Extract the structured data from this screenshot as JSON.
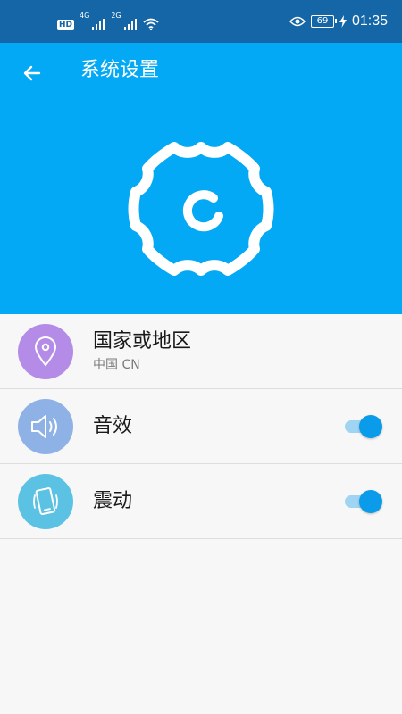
{
  "status_bar": {
    "hd_label": "HD",
    "net1_label": "4G",
    "net2_label": "2G",
    "battery_level": "69",
    "time": "01:35",
    "color": "#1566a6",
    "icons": [
      "hd-badge",
      "signal-bars-icon",
      "signal-bars-icon",
      "wifi-icon",
      "eye-icon",
      "battery-icon",
      "charging-icon"
    ]
  },
  "header": {
    "title": "系统设置",
    "back_icon": "arrow-left-icon",
    "hero_icon": "gear-icon",
    "background": "#03a9f4"
  },
  "settings": {
    "region": {
      "title": "国家或地区",
      "subtitle": "中国 CN",
      "icon": "location-pin-icon",
      "icon_color": "#b48ce8"
    },
    "sound": {
      "title": "音效",
      "icon": "speaker-icon",
      "icon_color": "#8fb2e6",
      "enabled": true
    },
    "vibration": {
      "title": "震动",
      "icon": "vibrate-phone-icon",
      "icon_color": "#5cc2e4",
      "enabled": true
    }
  },
  "colors": {
    "toggle_on": "#0a9bea",
    "toggle_track": "#9fd4f3"
  }
}
